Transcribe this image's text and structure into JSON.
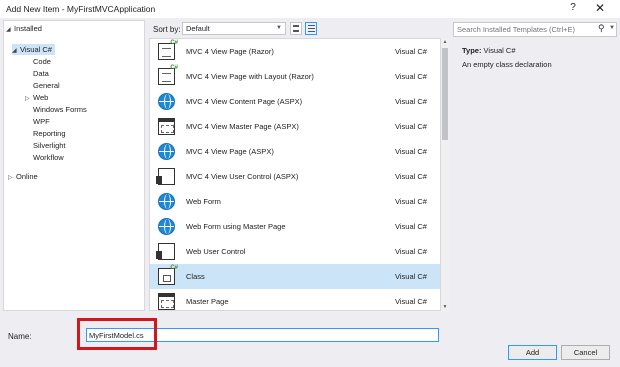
{
  "window": {
    "title": "Add New Item - MyFirstMVCApplication",
    "help": "?",
    "close": "✕"
  },
  "tree": {
    "installed": "Installed",
    "visual_csharp": "Visual C#",
    "children": [
      "Code",
      "Data",
      "General",
      "Web",
      "Windows Forms",
      "WPF",
      "Reporting",
      "Silverlight",
      "Workflow"
    ],
    "online": "Online"
  },
  "toolbar": {
    "sort_by_label": "Sort by:",
    "sort_value": "Default"
  },
  "search": {
    "placeholder": "Search Installed Templates (Ctrl+E)"
  },
  "templates": [
    {
      "name": "MVC 4 View Page (Razor)",
      "lang": "Visual C#",
      "icon": "razor-page-icon"
    },
    {
      "name": "MVC 4 View Page with Layout (Razor)",
      "lang": "Visual C#",
      "icon": "razor-page-icon"
    },
    {
      "name": "MVC 4 View Content Page (ASPX)",
      "lang": "Visual C#",
      "icon": "globe-icon"
    },
    {
      "name": "MVC 4 View Master Page (ASPX)",
      "lang": "Visual C#",
      "icon": "master-page-icon"
    },
    {
      "name": "MVC 4 View Page (ASPX)",
      "lang": "Visual C#",
      "icon": "globe-icon"
    },
    {
      "name": "MVC 4 View User Control (ASPX)",
      "lang": "Visual C#",
      "icon": "user-control-icon"
    },
    {
      "name": "Web Form",
      "lang": "Visual C#",
      "icon": "globe-icon"
    },
    {
      "name": "Web Form using Master Page",
      "lang": "Visual C#",
      "icon": "globe-icon"
    },
    {
      "name": "Web User Control",
      "lang": "Visual C#",
      "icon": "user-control-icon"
    },
    {
      "name": "Class",
      "lang": "Visual C#",
      "icon": "class-icon"
    },
    {
      "name": "Master Page",
      "lang": "Visual C#",
      "icon": "master-page-icon"
    }
  ],
  "description": {
    "type_label": "Type:",
    "type_value": "Visual C#",
    "text": "An empty class declaration"
  },
  "name_field": {
    "label": "Name:",
    "value": "MyFirstModel.cs"
  },
  "buttons": {
    "add": "Add",
    "cancel": "Cancel"
  },
  "colors": {
    "selection": "#cce4f7",
    "highlight_box": "#d0181c",
    "accent": "#3399ff"
  }
}
